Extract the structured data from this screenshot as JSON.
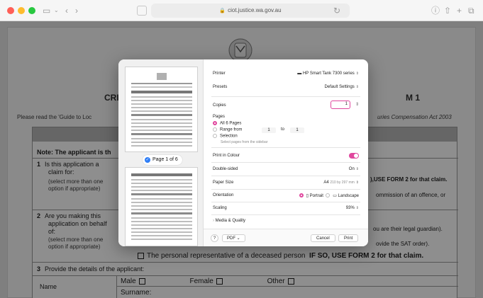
{
  "browser": {
    "url": "ciot.justice.wa.gov.au"
  },
  "document": {
    "title_left": "CRI",
    "title_right": "M 1",
    "read_text": "Please read the 'Guide to Loc",
    "act_text": "uries Compensation Act 2003",
    "note": "Note: The applicant is th",
    "q1": {
      "num": "1",
      "text_line1": "Is this application a",
      "text_line2": "claim for:",
      "sub_line1": "(select more than one",
      "sub_line2": "option if appropriate)",
      "right_line1": "),USE FORM 2 for that claim.",
      "right_line2": "ommission of an offence, or"
    },
    "q2": {
      "num": "2",
      "text_line1": "Are you making this",
      "text_line2": "application on behalf",
      "text_line3": "of:",
      "sub_line1": "(select more than one",
      "sub_line2": "option if appropriate)",
      "right_line1": "ou are their legal guardian).",
      "right_line2": "ovide the SAT order).",
      "bottom_prefix": "The personal representative of a deceased person",
      "bottom_bold": "IF SO, USE FORM 2 for that claim."
    },
    "q3": {
      "num": "3",
      "text": "Provide the details of the applicant:",
      "name_label": "Name",
      "male": "Male",
      "female": "Female",
      "other": "Other",
      "surname": "Surname:"
    }
  },
  "dialog": {
    "page_badge": "Page 1 of 6",
    "printer_label": "Printer",
    "printer_value": "HP Smart Tank 7300 series",
    "presets_label": "Presets",
    "presets_value": "Default Settings",
    "copies_label": "Copies",
    "copies_value": "1",
    "pages_label": "Pages",
    "all_pages": "All 6 Pages",
    "range_label": "Range from",
    "range_from": "1",
    "range_to_label": "to",
    "range_to": "1",
    "selection_label": "Selection",
    "selection_hint": "Select pages from the sidebar",
    "colour_label": "Print in Colour",
    "duplex_label": "Double-sided",
    "duplex_value": "On",
    "paper_label": "Paper Size",
    "paper_value": "A4",
    "paper_dims": "210 by 297 mm",
    "orientation_label": "Orientation",
    "portrait": "Portrait",
    "landscape": "Landscape",
    "scaling_label": "Scaling",
    "scaling_value": "93%",
    "media_label": "Media & Quality",
    "help": "?",
    "pdf": "PDF",
    "cancel": "Cancel",
    "print": "Print"
  },
  "colors": {
    "accent": "#e0479e",
    "badge_blue": "#2f7ef6"
  }
}
